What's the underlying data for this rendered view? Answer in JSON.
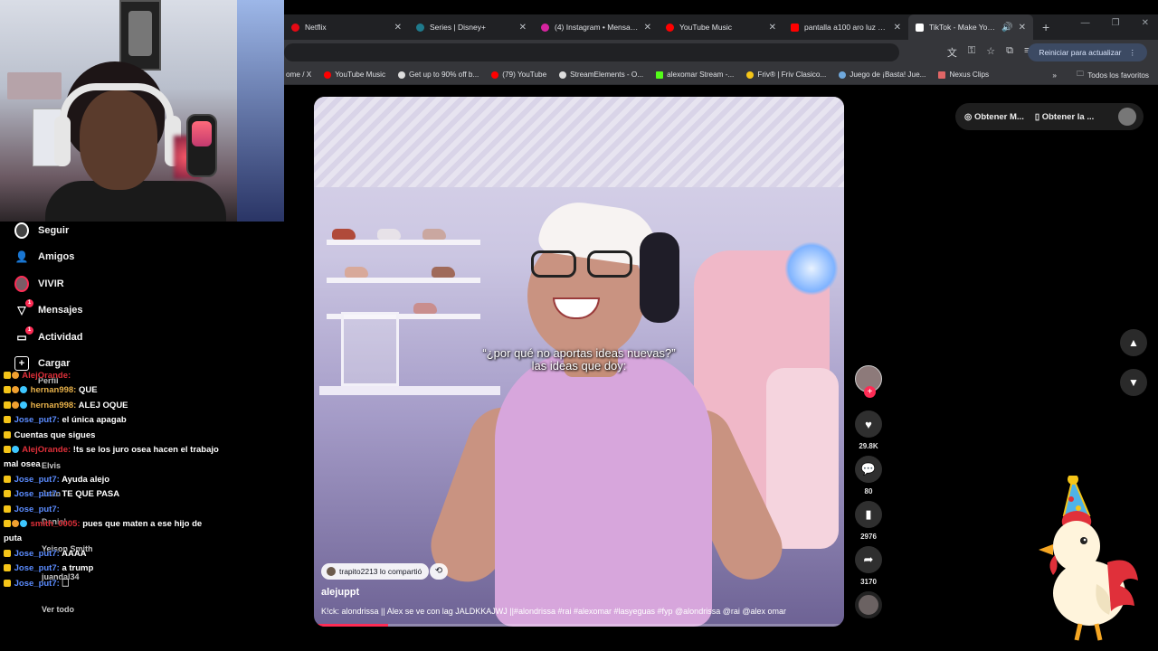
{
  "browser": {
    "tabs": [
      {
        "label": "Netflix",
        "color": "#e50914"
      },
      {
        "label": "Series | Disney+",
        "color": "#1f7a8c"
      },
      {
        "label": "(4) Instagram • Mensajes",
        "color": "#d6249f"
      },
      {
        "label": "YouTube Music",
        "color": "#ff0000"
      },
      {
        "label": "pantalla a100 aro luz blar",
        "color": "#ff0000"
      },
      {
        "label": "TikTok - Make Your D",
        "color": "#ffffff",
        "active": true
      }
    ],
    "new_tab": "+",
    "update_button": "Reiniciar para actualizar",
    "bookmarks": [
      {
        "label": "ome / X",
        "color": "#444"
      },
      {
        "label": "YouTube Music",
        "color": "#ff0000"
      },
      {
        "label": "Get up to 90% off b...",
        "color": "#dddddd"
      },
      {
        "label": "(79) YouTube",
        "color": "#ff0000"
      },
      {
        "label": "StreamElements - O...",
        "color": "#dddddd"
      },
      {
        "label": "alexomar Stream -...",
        "color": "#53fc18"
      },
      {
        "label": "Friv® | Friv Clasico...",
        "color": "#f5c518"
      },
      {
        "label": "Juego de ¡Basta! Jue...",
        "color": "#6fa8dc"
      },
      {
        "label": "Nexus Clips",
        "color": "#e06666"
      }
    ],
    "bookmarks_more": "»",
    "favorites_folder": "Todos los favoritos"
  },
  "sidebar": {
    "items": [
      {
        "label": "Seguir",
        "icon": "following-avatar-icon"
      },
      {
        "label": "Amigos",
        "icon": "friends-icon"
      },
      {
        "label": "VIVIR",
        "icon": "live-avatar-icon"
      },
      {
        "label": "Mensajes",
        "icon": "messages-icon",
        "badge": "1"
      },
      {
        "label": "Actividad",
        "icon": "activity-icon",
        "badge": "1"
      },
      {
        "label": "Cargar",
        "icon": "upload-icon"
      }
    ]
  },
  "chat": {
    "messages": [
      {
        "user": "AlejOrande:",
        "text": "",
        "user_color": "red"
      },
      {
        "user": "hernan998:",
        "text": "QUE",
        "user_color": "gold"
      },
      {
        "user": "hernan998:",
        "text": "ALEJ OQUE",
        "user_color": "gold"
      },
      {
        "user": "Jose_put7:",
        "text": "el única apagab",
        "user_color": "blue"
      },
      {
        "user": "",
        "text": "Cuentas que sigues",
        "user_color": "blue"
      },
      {
        "user": "AlejOrande:",
        "text": "!ts se los juro osea hacen el trabajo mal osea",
        "user_color": "red"
      },
      {
        "user": "Jose_put7:",
        "text": "Ayuda alejo",
        "user_color": "blue"
      },
      {
        "user": "Jose_put7:",
        "text": "TE QUE PASA",
        "user_color": "blue"
      },
      {
        "user": "Jose_put7:",
        "text": "",
        "user_color": "blue"
      },
      {
        "user": "smith_0005:",
        "text": "pues que maten a ese hijo de puta",
        "user_color": "red"
      },
      {
        "user": "Jose_put7:",
        "text": "AAAA",
        "user_color": "blue"
      },
      {
        "user": "Jose_put7:",
        "text": "a trump",
        "user_color": "blue"
      },
      {
        "user": "Jose_put7:",
        "text": "🗌",
        "user_color": "blue"
      }
    ],
    "ghost_labels": [
      "Perfil",
      "Elvis",
      "Juan",
      "Daniel",
      "Yeison Smith",
      "juandal34",
      "Ver todo"
    ]
  },
  "video": {
    "caption_line1": "“¿por qué no aportas ideas nuevas?”",
    "caption_line2": "las ideas que doy:",
    "shared_by": "trapito2213 lo compartió",
    "author": "alejuppt",
    "description": "K!ck: alondrissa || Alex se ve con lag JALDKKAJWJ ||#alondrissa #rai #alexomar #lasyeguas #fyp @alondrissa @rai @alex omar",
    "progress": 0.14
  },
  "actions": {
    "likes": "29.8K",
    "comments": "80",
    "saves": "2976",
    "shares": "3170"
  },
  "top_right": {
    "get_app": "Obtener M...",
    "get_desktop": "Obtener la ..."
  }
}
